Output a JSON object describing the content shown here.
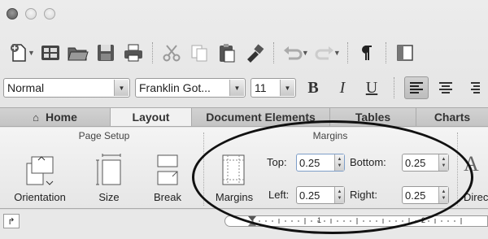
{
  "standard_toolbar": {
    "icons": [
      "new-document-icon",
      "templates-gallery-icon",
      "open-folder-icon",
      "save-icon",
      "print-icon",
      "cut-icon",
      "copy-icon",
      "paste-icon",
      "format-painter-icon",
      "undo-icon",
      "redo-icon",
      "pilcrow-icon",
      "sidebar-icon"
    ]
  },
  "formatting": {
    "style": "Normal",
    "font": "Franklin Got...",
    "size": "11",
    "bold": "B",
    "italic": "I",
    "underline": "U"
  },
  "tabs": [
    {
      "label": "Home"
    },
    {
      "label": "Layout"
    },
    {
      "label": "Document Elements"
    },
    {
      "label": "Tables"
    },
    {
      "label": "Charts"
    }
  ],
  "ribbon": {
    "page_setup": {
      "title": "Page Setup",
      "buttons": [
        {
          "label": "Orientation"
        },
        {
          "label": "Size"
        },
        {
          "label": "Break"
        }
      ]
    },
    "margins": {
      "title": "Margins",
      "button_label": "Margins",
      "top_label": "Top:",
      "top_value": "0.25",
      "bottom_label": "Bottom:",
      "bottom_value": "0.25",
      "left_label": "Left:",
      "left_value": "0.25",
      "right_label": "Right:",
      "right_value": "0.25"
    },
    "text_direction_label": "Direc"
  },
  "ruler": {
    "numbers": [
      "1",
      "2"
    ]
  }
}
